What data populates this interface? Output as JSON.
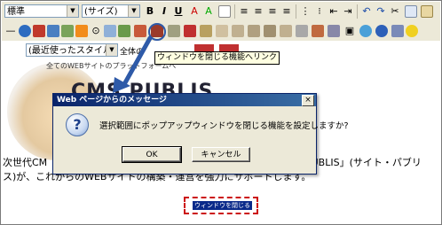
{
  "toolbar1": {
    "style_select": "標準",
    "size_select": "(サイズ)",
    "bold_icon": "B",
    "italic_icon": "I",
    "underline_icon": "U"
  },
  "toolbar2": {
    "recent_style_select": "(最近使ったスタイル)",
    "select_all_label": "全体の"
  },
  "tooltip": "ウィンドウを閉じる機能へリンク",
  "content": {
    "logo_small_text": "全てのWEBサイトのプラットフォームへ",
    "logo_big_text": "CMS PUBLIS",
    "body_line1_start": "次世代CM",
    "body_line1_end": "PUBLIS」(サイト・パブリ",
    "body_line2": "ス)が、これからのWEBサイトの構築・運営を強力にサポートします。",
    "link_label": "ウィンドウを閉じる"
  },
  "dialog": {
    "title": "Web ページからのメッセージ",
    "close_label": "×",
    "icon_glyph": "?",
    "message": "選択範囲にポップアップウィンドウを閉じる機能を設定しますか?",
    "ok_label": "OK",
    "cancel_label": "キャンセル"
  },
  "colors": {
    "title_bar": "#0a246a",
    "highlight_dashed": "#cc1111",
    "callout": "#2e5aa8"
  }
}
